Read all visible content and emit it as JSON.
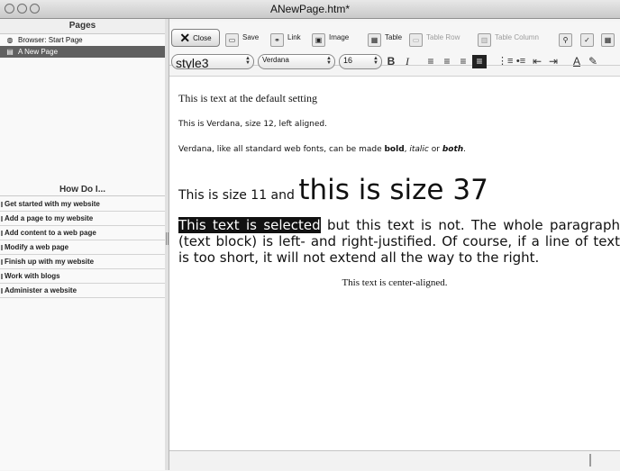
{
  "window": {
    "title": "ANewPage.htm*"
  },
  "left_pane": {
    "pages_title": "Pages",
    "pages": [
      {
        "label": "Browser: Start Page",
        "icon": "browser-icon"
      },
      {
        "label": "A New Page",
        "icon": "page-icon",
        "selected": true
      }
    ],
    "how_title": "How Do I...",
    "how_items": [
      "Get started with my website",
      "Add a page to my website",
      "Add content to a web page",
      "Modify a web page",
      "Finish up with my website",
      "Work with blogs",
      "Administer a website"
    ]
  },
  "toolbar": {
    "close_label": "Close",
    "save_label": "Save",
    "link_label": "Link",
    "image_label": "Image",
    "table_label": "Table",
    "table_row_label": "Table Row",
    "table_column_label": "Table Column"
  },
  "format_bar": {
    "style": "style3",
    "font": "Verdana",
    "size": "16",
    "bold": "B",
    "italic": "I"
  },
  "editor": {
    "line1": "This is text at the default setting",
    "line2": "This is Verdana, size 12, left aligned.",
    "line3_pre": "Verdana, like all standard web fonts, can be made ",
    "bold": "bold",
    "comma": ", ",
    "italic": "italic",
    "or": " or ",
    "both": "both",
    "period": ".",
    "size11_text": "This is size 11 and ",
    "size37_text": "this is size 37",
    "selected_text": "This text is selected",
    "justified_rest": " but this text is not. The whole paragraph (text block) is left- and right-justified. Of course, if a line of text is too short, it will not extend all the way to the right.",
    "center_text": "This text is center-aligned."
  }
}
